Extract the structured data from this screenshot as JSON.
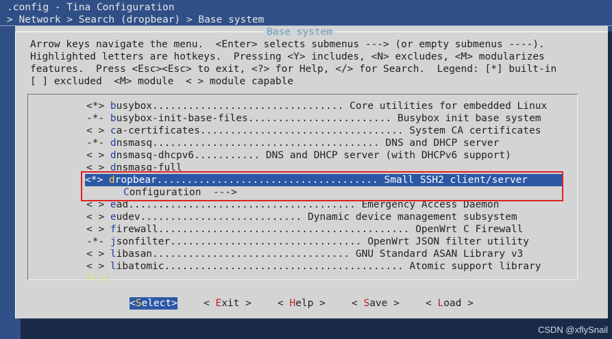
{
  "header": {
    "title": ".config - Tina Configuration",
    "breadcrumb": "> Network > Search (dropbear) > Base system"
  },
  "dialog": {
    "title": "Base system",
    "help_lines": [
      "Arrow keys navigate the menu.  <Enter> selects submenus ---> (or empty submenus ----).",
      "Highlighted letters are hotkeys.  Pressing <Y> includes, <N> excludes, <M> modularizes",
      "features.  Press <Esc><Esc> to exit, <?> for Help, </> for Search.  Legend: [*] built-in",
      "[ ] excluded  <M> module  < > module capable"
    ]
  },
  "menu": {
    "items": [
      {
        "mark": "<*> ",
        "hot": "b",
        "rest": "usybox................................ ",
        "desc": "Core utilities for embedded Linux"
      },
      {
        "mark": "-*- ",
        "hot": "b",
        "rest": "usybox-init-base-files........................ ",
        "desc": "Busybox init base system"
      },
      {
        "mark": "< > ",
        "hot": "c",
        "rest": "a-certificates.................................. ",
        "desc": "System CA certificates"
      },
      {
        "mark": "-*- ",
        "hot": "d",
        "rest": "nsmasq...................................... ",
        "desc": "DNS and DHCP server"
      },
      {
        "mark": "< > ",
        "hot": "d",
        "rest": "nsmasq-dhcpv6........... ",
        "desc": "DNS and DHCP server (with DHCPv6 support)"
      },
      {
        "mark": "< > ",
        "hot": "d",
        "rest": "nsmasq-full",
        "desc": ""
      },
      {
        "mark": "<*> ",
        "hot": "d",
        "rest": "ropbear..................................... ",
        "desc": "Small SSH2 client/server"
      },
      {
        "mark": "",
        "hot": "C",
        "rest": "onfiguration  --->",
        "desc": ""
      },
      {
        "mark": "< > ",
        "hot": "e",
        "rest": "ad...................................... ",
        "desc": "Emergency Access Daemon"
      },
      {
        "mark": "< > ",
        "hot": "e",
        "rest": "udev........................... ",
        "desc": "Dynamic device management subsystem"
      },
      {
        "mark": "< > ",
        "hot": "f",
        "rest": "irewall.......................................... ",
        "desc": "OpenWrt C Firewall"
      },
      {
        "mark": "-*- ",
        "hot": "j",
        "rest": "sonfilter................................ ",
        "desc": "OpenWrt JSON filter utility"
      },
      {
        "mark": "< > ",
        "hot": "l",
        "rest": "ibasan................................. ",
        "desc": "GNU Standard ASAN Library v3"
      },
      {
        "mark": "< > ",
        "hot": "l",
        "rest": "ibatomic........................................ ",
        "desc": "Atomic support library"
      }
    ],
    "more_indicator": "┴(+)"
  },
  "buttons": [
    {
      "pre": "<",
      "hot": "S",
      "rest": "elect>"
    },
    {
      "pre": "< ",
      "hot": "E",
      "rest": "xit >"
    },
    {
      "pre": "< ",
      "hot": "H",
      "rest": "elp >"
    },
    {
      "pre": "< ",
      "hot": "S",
      "rest": "ave >"
    },
    {
      "pre": "< ",
      "hot": "L",
      "rest": "oad >"
    }
  ],
  "watermark": "CSDN @xflySnail",
  "colors": {
    "background": "#2f4f86",
    "dialog": "#d4d4d4",
    "selection": "#2b57a5",
    "hotkey": "#1f3fa6",
    "selected_hotkey": "#ffd34a",
    "button_hotkey": "#c02020",
    "highlight_frame": "#e02020"
  }
}
